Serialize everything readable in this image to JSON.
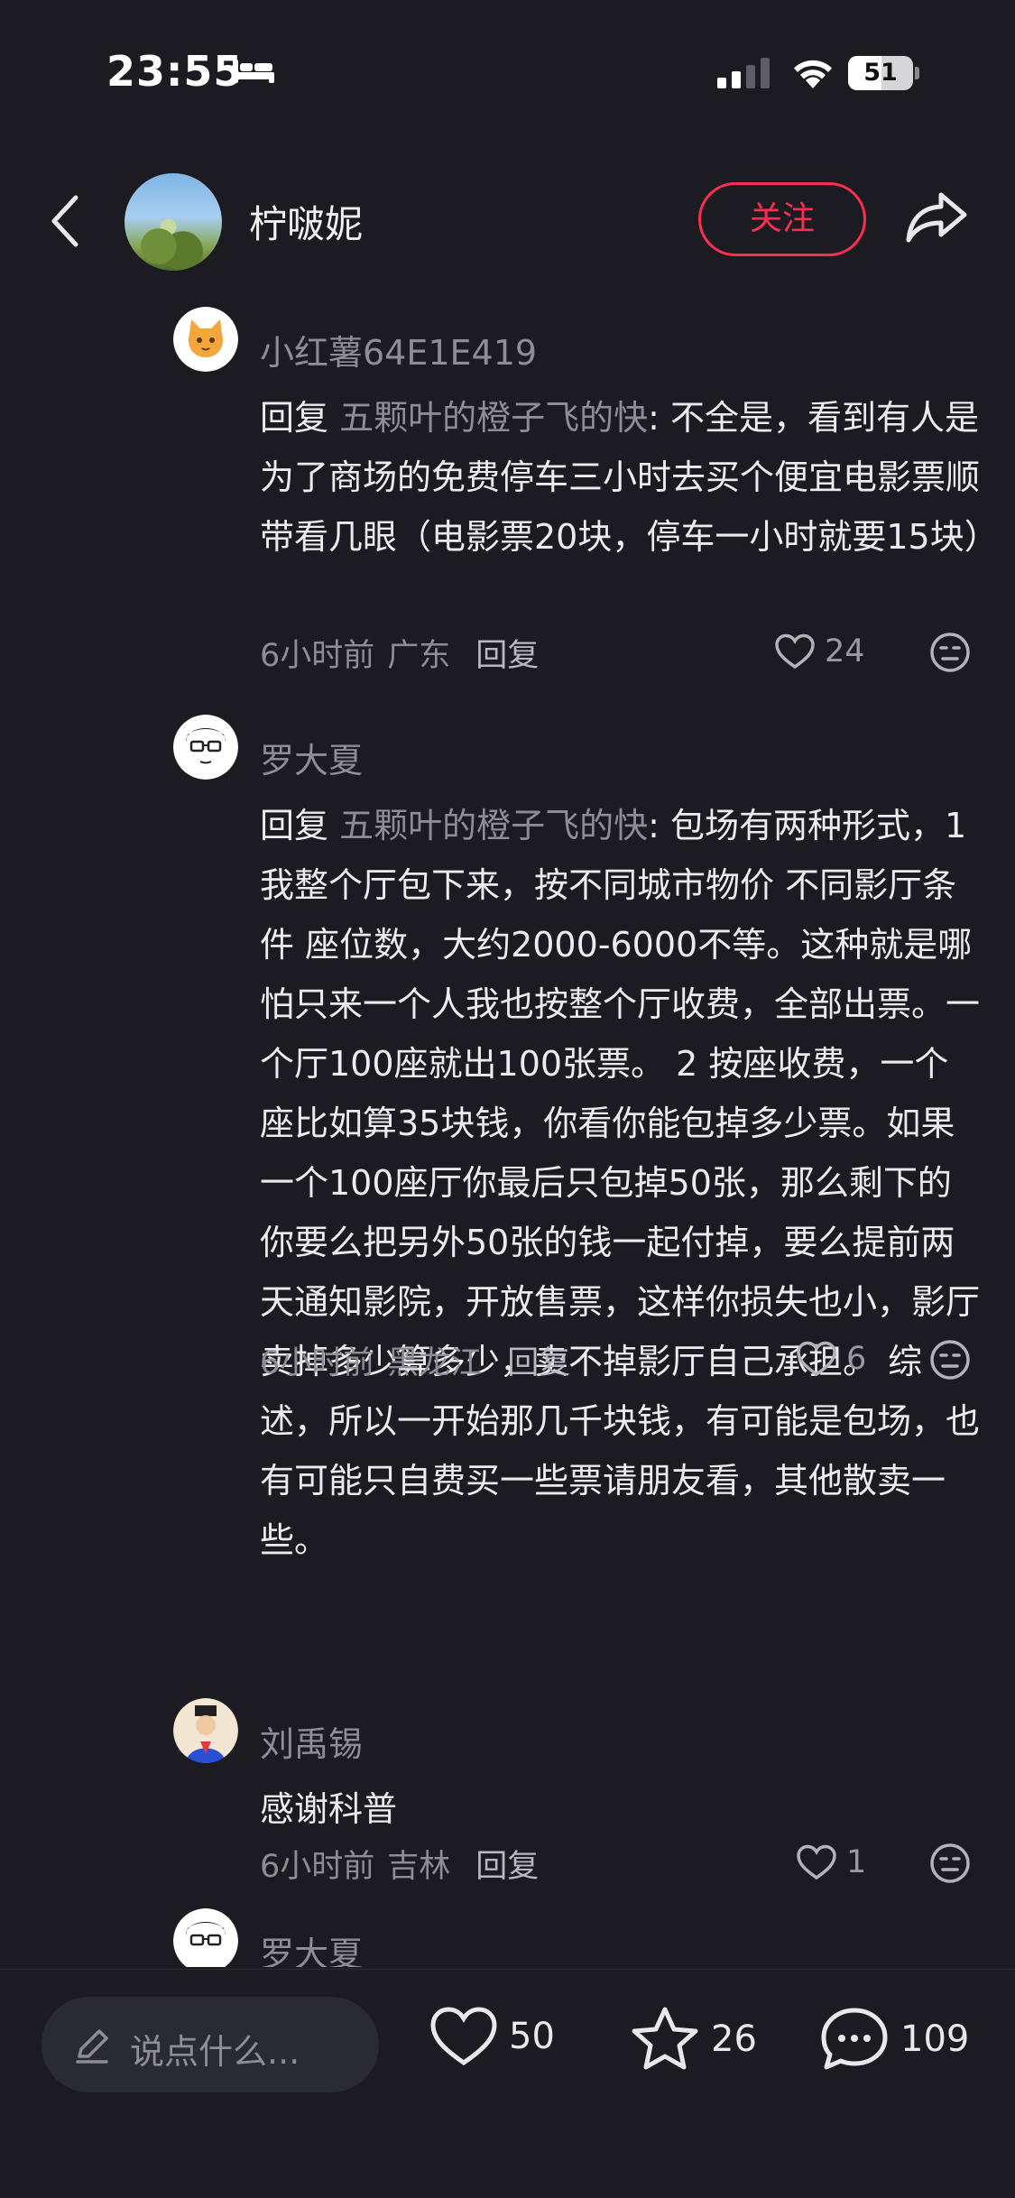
{
  "status_bar": {
    "time": "23:55",
    "battery": "51",
    "battery_level": 0.51
  },
  "header": {
    "author_name": "柠啵妮",
    "follow_label": "关注"
  },
  "comments": [
    {
      "username": "小红薯64E1E419",
      "reply_prefix": "回复 ",
      "reply_target": "五颗叶的橙子飞的快",
      "text": ": 不全是，看到有人是为了商场的免费停车三小时去买个便宜电影票顺带看几眼（电影票20块，停车一小时就要15块）",
      "time": "6小时前",
      "location": "广东",
      "reply_label": "回复",
      "likes": "24"
    },
    {
      "username": "罗大夏",
      "reply_prefix": "回复 ",
      "reply_target": "五颗叶的橙子飞的快",
      "text": ": 包场有两种形式，1 我整个厅包下来，按不同城市物价 不同影厅条件 座位数，大约2000-6000不等。这种就是哪怕只来一个人我也按整个厅收费，全部出票。一个厅100座就出100张票。 2 按座收费，一个座比如算35块钱，你看你能包掉多少票。如果一个100座厅你最后只包掉50张，那么剩下的你要么把另外50张的钱一起付掉，要么提前两天通知影院，开放售票，这样你损失也小，影厅卖掉多少算多少，卖不掉影厅自己承担。 综述，所以一开始那几千块钱，有可能是包场，也有可能只自费买一些票请朋友看，其他散卖一些。",
      "time": "6小时前",
      "location": "黑龙江",
      "reply_label": "回复",
      "likes": "6"
    },
    {
      "username": "刘禹锡",
      "text": "感谢科普",
      "time": "6小时前",
      "location": "吉林",
      "reply_label": "回复",
      "likes": "1"
    },
    {
      "username": "罗大夏"
    }
  ],
  "bottom_bar": {
    "input_placeholder": "说点什么...",
    "likes": "50",
    "collects": "26",
    "comments": "109"
  },
  "colors": {
    "background": "#1c1b21",
    "accent": "#ff2d52",
    "muted_text": "#8e8d96"
  }
}
